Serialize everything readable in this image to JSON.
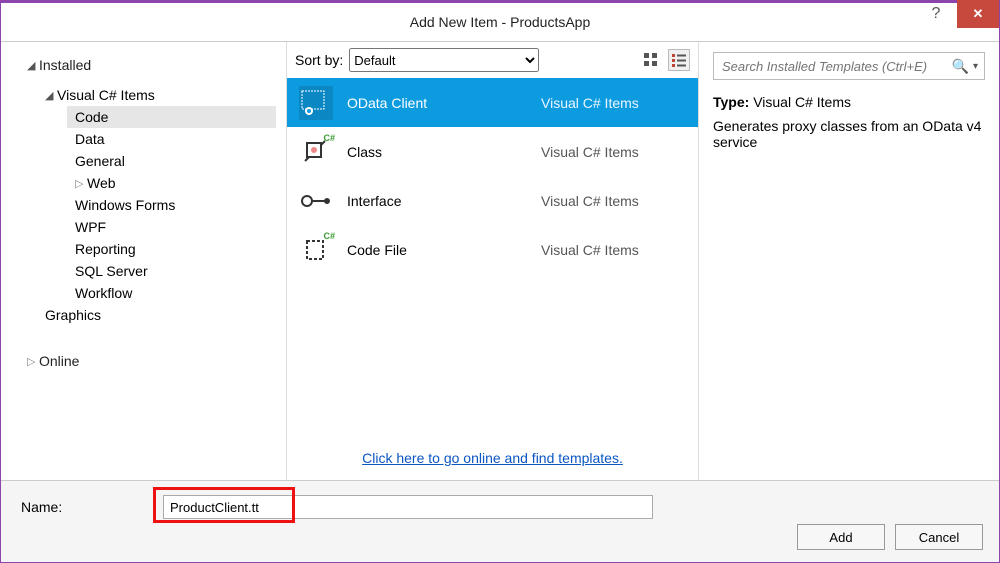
{
  "window": {
    "title": "Add New Item - ProductsApp"
  },
  "sidebar": {
    "installed": "Installed",
    "csharp": "Visual C# Items",
    "items": [
      "Code",
      "Data",
      "General",
      "Web",
      "Windows Forms",
      "WPF",
      "Reporting",
      "SQL Server",
      "Workflow"
    ],
    "graphics": "Graphics",
    "online": "Online"
  },
  "sortbar": {
    "label": "Sort by:",
    "value": "Default"
  },
  "templates": [
    {
      "name": "OData Client",
      "lang": "Visual C# Items",
      "selected": true
    },
    {
      "name": "Class",
      "lang": "Visual C# Items",
      "selected": false
    },
    {
      "name": "Interface",
      "lang": "Visual C# Items",
      "selected": false
    },
    {
      "name": "Code File",
      "lang": "Visual C# Items",
      "selected": false
    }
  ],
  "link": "Click here to go online and find templates.",
  "search": {
    "placeholder": "Search Installed Templates (Ctrl+E)"
  },
  "details": {
    "type_label": "Type:",
    "type_value": "Visual C# Items",
    "description": "Generates proxy classes from an OData v4 service"
  },
  "name_row": {
    "label": "Name:",
    "value": "ProductClient.tt"
  },
  "buttons": {
    "add": "Add",
    "cancel": "Cancel"
  }
}
